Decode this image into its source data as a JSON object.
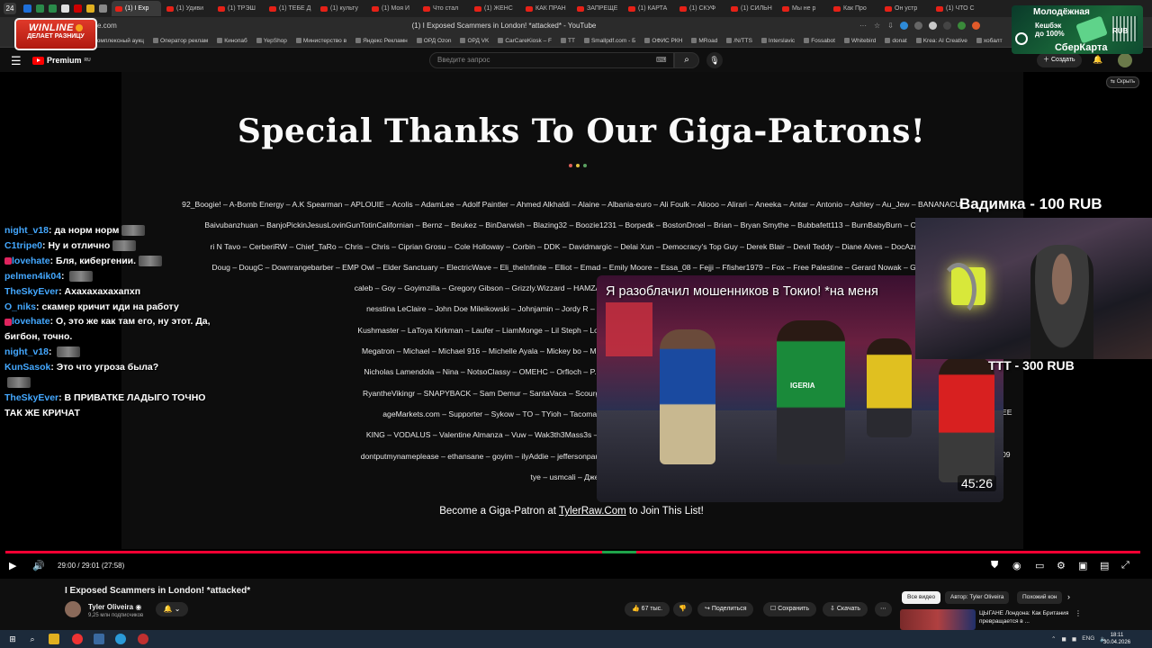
{
  "browser": {
    "tab_count": "24",
    "tabs": [
      "(1) I Exp",
      "(1) Удиви",
      "(1) ТРЭШ",
      "(1) ТЕБЕ Д",
      "(1) культу",
      "(1) Моя И",
      "Что стал",
      "(1) ЖЕНС",
      "КАК ПРАН",
      "ЗАПРЕЩЕ",
      "(1) КАРТА",
      "(1) СКУФ",
      "(1) СИЛЬН",
      "Мы не р",
      "Как Про",
      "Он устр",
      "(1) ЧТО С"
    ],
    "url_host": "e.com",
    "page_title": "(1) I Exposed Scammers in London! *attacked* - YouTube",
    "bookmarks": [
      "Комплексный аукц",
      "Оператор реклам",
      "Кинопаб",
      "YepShop",
      "Министерство в",
      "Яндекс Рекламн",
      "ОРД Ozon",
      "ОРД VK",
      "CarCareKiosk – F",
      "TT",
      "Smallpdf.com - Б",
      "ОФИС РКН",
      "MRoad",
      "/N/TTS",
      "Interslavic",
      "Fossabot",
      "Whitebird",
      "donat",
      "Krea: AI Creative",
      "хобалт"
    ]
  },
  "ads": {
    "winline_brand": "WINLINE",
    "winline_tagline": "ДЕЛАЕТ РАЗНИЦУ",
    "sber_line1": "Молодёжная",
    "sber_line2": "Кешбэк",
    "sber_line3": "до 100%",
    "sber_line4": "RUB",
    "sber_brand": "СберКарта"
  },
  "youtube": {
    "premium_label": "Premium",
    "premium_sup": "RU",
    "search_placeholder": "Введите запрос",
    "create_label": "Создать",
    "hide_label": "Скрыть"
  },
  "slide": {
    "title": "Special Thanks To Our Giga-Patrons!",
    "patron_rows": [
      "92_Boogie! – A-Bomb Energy – A.K Spearman – APLOUIE – Acolis – AdamLee – Adolf Paintler – Ahmed Alkhaldi – Alaine – Albania-euro – Ali Foulk – Aliooo – Alirari – Aneeka – Antar – Antonio – Ashley – Au_Jew – BANANACU",
      "Baivubanzhuan – BanjoPickinJesusLovinGunTotinCalifornian – Bernz – Beukez – BinDarwish – Blazing32 – Boozie1231 – Borpedk – BostonDroel – Brian – Bryan Smythe – Bubbafett113 – BurnBabyBurn – Caleb R",
      "ri N Tavo – CerberiRW – Chief_TaRo – Chris – Chris – Ciprian Grosu – Cole Holloway – Corbin – DDK – Davidmargic – Delai Xun – Democracy's Top Guy – Derek Blair – Devil Teddy – Diane Alves – DocAznabel",
      "Doug – DougC – Downrangebarber – EMP Owl – Elder Sanctuary – ElectricWave – Eli_theInfinite – Elliot – Emad – Emily Moore – Essa_08 – Fejji – Ffisher1979 – Fox – Free Palestine – Gerard Nowak – Gman",
      "caleb – Goy – Goyimzilla – Gregory Gibson – Grizzly.Wizzard – HAMZA ALGABYALI – Hunter Phillips – Illo – Impressed – Isaa",
      "nesstina LeClaire – John Doe Mileikowski – Johnjamin – Jordy R – Journey2Dom – Just Another User – Justice – Justin",
      "Kushmaster – LaToya Kirkman – Laufer – LiamMonge – Lil Steph – Lord LaVance – Majik – Majik30590 – Makuraa – Maria L",
      "Megatron – Michael – Michael 916 – Michelle Ayala – Mickey bo – Mike Jones – Mike2Live – Mooninite – Morbidpete – Mr.",
      "Nicholas Lamendola – Nina – NotsoClassy – OMEHC – Orfloch – P.M. – Parabolicdeth – Patrick Gunnels – Penguini – Pr",
      "RyantheVikingr – SNAPYBACK – Sam Demur – SantaVaca – Scourgeotw29 – Simon Feghali – Sisiiiii – Skooma Boutique",
      "ageMarkets.com – Supporter – Sykow – TO – TYioh – Tacomanser – Talgat A. – TastyThai – The Fog Machine",
      "KING – VODALUS – Valentine Almanza – Vuw – Wak3th3Mass3s – Whatever Reason – Will T – Willy.D.Dawg – Willy2v",
      "dontputmynameplease – ethansane – goyim – ilyAddie – jeffersonpauljones – keyfobs – linkblends – masken94 – matealve",
      "tye – usmcali – Джеймс"
    ],
    "become_prefix": "Become a Giga-Patron at ",
    "become_link": "TylerRaw.Com",
    "become_suffix": " to Join This List!",
    "right_edge_fragments": [
      "EE",
      "09"
    ]
  },
  "chat": [
    {
      "user": "night_v18",
      "text": "да норм норм",
      "emote": true
    },
    {
      "user": "C1tripe0",
      "text": "Ну и отлично",
      "emote": true
    },
    {
      "user": "lovehate",
      "text": "Бля, кибергении.",
      "emote": true,
      "badge": true
    },
    {
      "user": "pelmen4ik04",
      "text": "",
      "emote": true
    },
    {
      "user": "TheSkyEver",
      "text": "Ахахахахахапхп"
    },
    {
      "user": "O_niks",
      "text": "скамер кричит иди на работу"
    },
    {
      "user": "lovehate",
      "text": "О, это же как там его, ну этот. Да, бигбон, точно.",
      "badge": true
    },
    {
      "user": "night_v18",
      "text": "",
      "emote": true
    },
    {
      "user": "KunSasok",
      "text": "Это что угроза была?"
    },
    {
      "user": "",
      "text": "",
      "emote": true
    },
    {
      "user": "TheSkyEver",
      "text": "В ПРИВАТКЕ ЛАДЫГО ТОЧНО ТАК ЖЕ КРИЧАТ"
    }
  ],
  "donations": [
    "Вадимка - 100 RUB",
    "ТТТ - 300 RUB"
  ],
  "endcard": {
    "title": "Я разоблачил мошенников в Токио! *на меня",
    "duration": "45:26",
    "jersey_text": "IGERIA"
  },
  "player": {
    "time": "29:00 / 29:01 (27:58)",
    "progress_fraction": 0.999
  },
  "video_meta": {
    "title": "I Exposed Scammers in London! *attacked*",
    "channel": "Tyler Oliveira",
    "subscribers": "9,25 млн подписчиков",
    "likes": "67 тыс.",
    "share": "Поделиться",
    "save": "Сохранить",
    "download": "Скачать"
  },
  "chips": [
    "Все видео",
    "Автор: Tyler Oliveira",
    "Похожий кон"
  ],
  "recommended": {
    "title": "ЦЫГАНЕ Лондона: Как Британия превращается в ..."
  },
  "taskbar": {
    "lang": "ENG",
    "time": "18:11",
    "date": "30.04.2026"
  },
  "colors": {
    "progress": "#ff0033",
    "chat_user": "#44a8ff",
    "brand_red": "#ff0000"
  }
}
